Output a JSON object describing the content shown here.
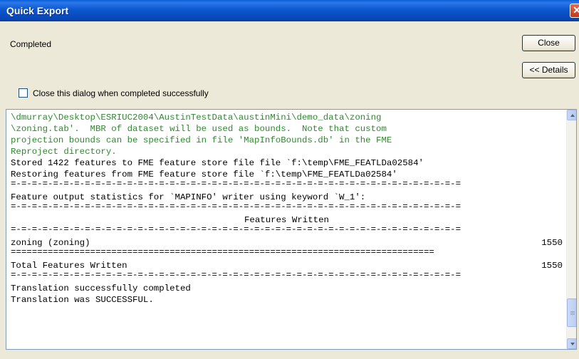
{
  "window": {
    "title": "Quick Export",
    "close_glyph": "✕"
  },
  "status": "Completed",
  "buttons": {
    "close": "Close",
    "details": "<< Details"
  },
  "checkbox": {
    "label": "Close this dialog when completed successfully",
    "checked": false
  },
  "log": {
    "top_fragment": "- - - - - - - - - - - - - - - - - - - - - - - - - - - - - - - - - - -",
    "green_lines": [
      "\\dmurray\\Desktop\\ESRIUC2004\\AustinTestData\\austinMini\\demo_data\\zoning",
      "\\zoning.tab'.  MBR of dataset will be used as bounds.  Note that custom",
      "projection bounds can be specified in file 'MapInfoBounds.db' in the FME",
      "Reproject directory."
    ],
    "stored_line": "Stored 1422 features to FME feature store file file `f:\\temp\\FME_FEATLDa02584'",
    "restoring_line": "Restoring features from FME feature store file `f:\\temp\\FME_FEATLDa02584'",
    "dash_separator": "=-=-=-=-=-=-=-=-=-=-=-=-=-=-=-=-=-=-=-=-=-=-=-=-=-=-=-=-=-=-=-=-=-=-=-=-=-=-=-=-=-=-=",
    "stats_line": "Feature output statistics for `MAPINFO' writer using keyword `W_1':",
    "features_written_header": "Features Written",
    "feature_row": {
      "label": "zoning (zoning)",
      "count": "1550"
    },
    "equals_separator": "================================================================================",
    "total_row": {
      "label": "Total Features Written",
      "count": "1550"
    },
    "success_line_1": "Translation successfully completed",
    "success_line_2": "Translation was SUCCESSFUL."
  },
  "colors": {
    "title_bar": "#0a4fd0",
    "dialog_bg": "#ece9d8",
    "green_text": "#2f8a2f"
  }
}
